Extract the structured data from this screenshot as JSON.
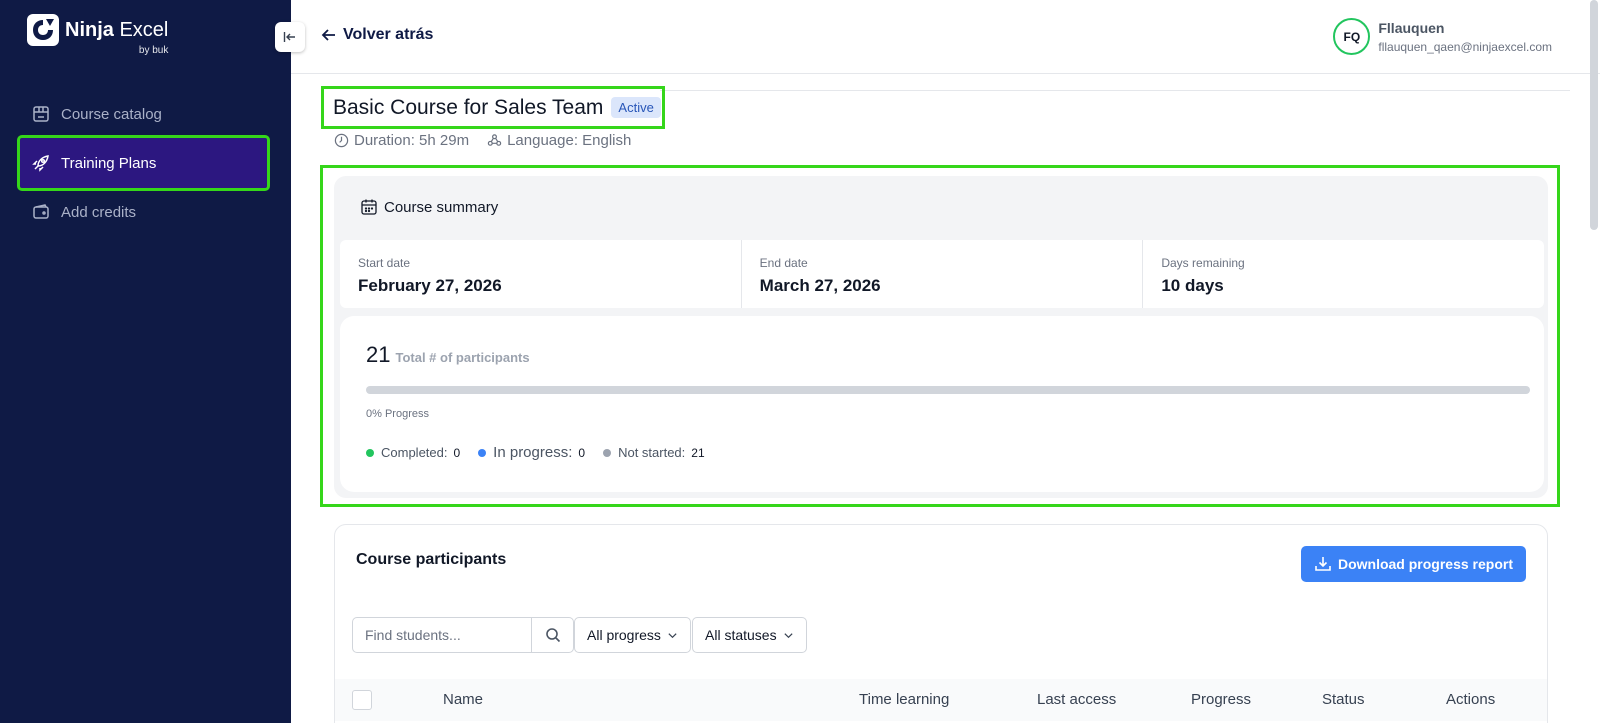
{
  "brand": {
    "name_bold": "Ninja",
    "name_rest": " Excel",
    "byline": "by buk"
  },
  "sidebar": {
    "items": [
      {
        "label": "Course catalog",
        "icon": "store-icon",
        "active": false
      },
      {
        "label": "Training Plans",
        "icon": "rocket-icon",
        "active": true
      },
      {
        "label": "Add credits",
        "icon": "wallet-icon",
        "active": false
      }
    ]
  },
  "header": {
    "back_label": "Volver atrás",
    "user": {
      "initials": "FQ",
      "name": "Fllauquen",
      "email": "fllauquen_qaen@ninjaexcel.com"
    }
  },
  "course": {
    "title": "Basic Course for Sales Team",
    "status_badge": "Active",
    "duration": "Duration: 5h 29m",
    "language": "Language: English"
  },
  "summary": {
    "heading": "Course summary",
    "start_label": "Start date",
    "start_value": "February 27, 2026",
    "end_label": "End date",
    "end_value": "March 27, 2026",
    "remaining_label": "Days remaining",
    "remaining_value": "10 days",
    "total_participants": "21",
    "total_label": "Total # of participants",
    "progress_percent": 0,
    "progress_label": "0% Progress",
    "legend": {
      "completed_label": "Completed:",
      "completed_count": "0",
      "completed_color": "#22c55e",
      "in_progress_label": "In progress:",
      "in_progress_count": "0",
      "in_progress_color": "#3b82f6",
      "not_started_label": "Not started:",
      "not_started_count": "21",
      "not_started_color": "#9ca3af"
    }
  },
  "participants": {
    "title": "Course participants",
    "download_label": "Download progress report",
    "search_placeholder": "Find students...",
    "progress_filter": "All progress",
    "status_filter": "All statuses",
    "columns": [
      "Name",
      "Time learning",
      "Last access",
      "Progress",
      "Status",
      "Actions"
    ]
  },
  "colors": {
    "sidebar_bg": "#0f1a45",
    "active_item_bg": "#2c1780",
    "highlight": "#35d61a",
    "accent": "#3b82f6"
  }
}
